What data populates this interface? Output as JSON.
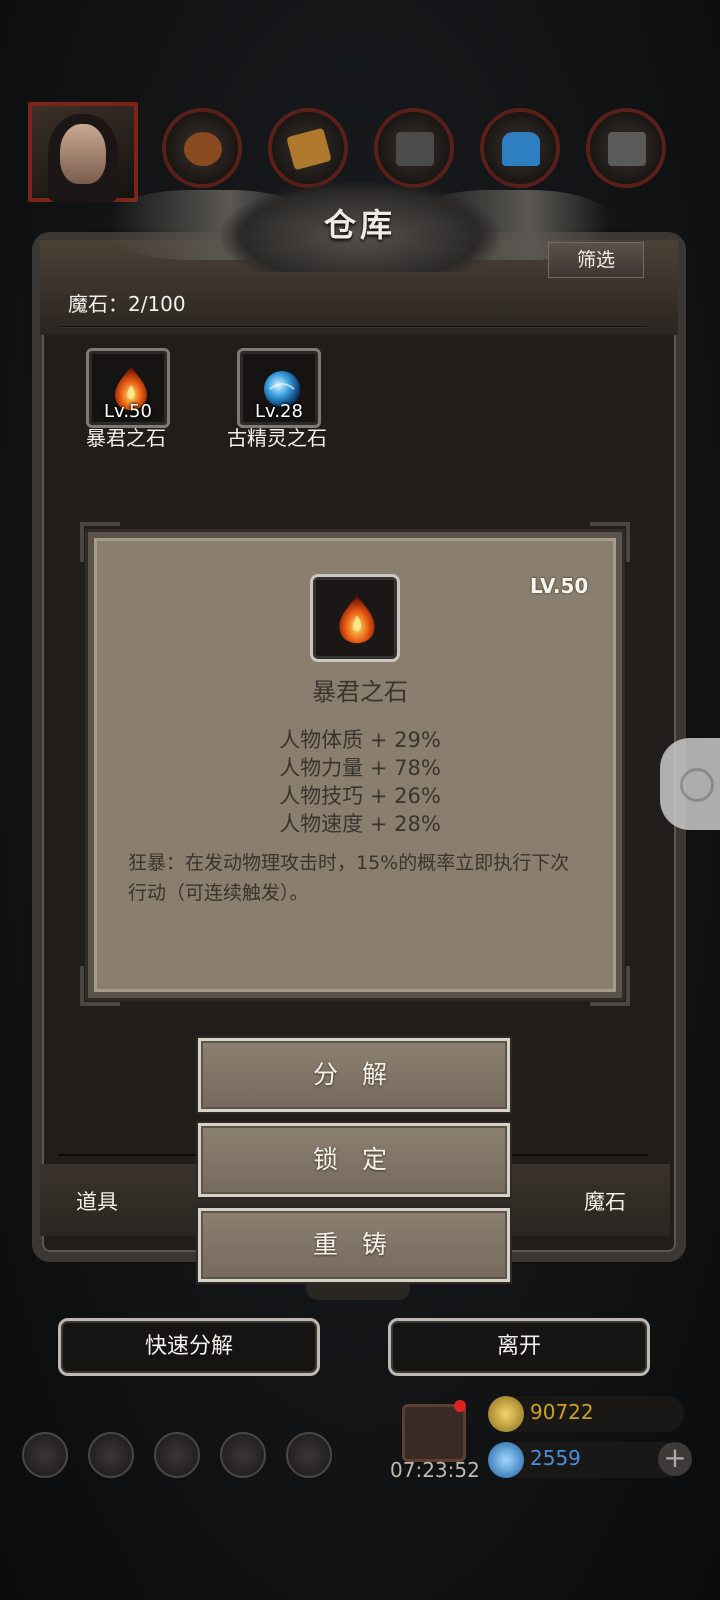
{
  "top_bar": {
    "resource_icons": [
      "wood-icon",
      "plank-icon",
      "iron-icon",
      "crystal-icon",
      "stone-icon"
    ]
  },
  "warehouse": {
    "title": "仓库",
    "filter_label": "筛选",
    "capacity_label": "魔石：2/100",
    "items": [
      {
        "level": "Lv.50",
        "name": "暴君之石",
        "icon": "fire-gem-icon"
      },
      {
        "level": "Lv.28",
        "name": "古精灵之石",
        "icon": "water-gem-icon"
      }
    ]
  },
  "detail": {
    "level": "LV.50",
    "name": "暴君之石",
    "icon": "fire-gem-icon",
    "stats": [
      "人物体质 + 29%",
      "人物力量 + 78%",
      "人物技巧 + 26%",
      "人物速度 + 28%"
    ],
    "effect": "狂暴：在发动物理攻击时，15%的概率立即执行下次行动（可连续触发）。"
  },
  "actions": {
    "decompose": "分 解",
    "lock": "锁 定",
    "reforge": "重 铸"
  },
  "tabs": {
    "left": "道具",
    "right": "魔石"
  },
  "bottom_buttons": {
    "quick_decompose": "快速分解",
    "leave": "离开"
  },
  "hud": {
    "timer": "07:23:52",
    "gold": "90722",
    "gems": "2559"
  },
  "colors": {
    "panel_bg": "#201d1b",
    "card_bg": "#8a7f6f",
    "gold_text": "#c9a227",
    "gem_text": "#4a8fd8"
  }
}
